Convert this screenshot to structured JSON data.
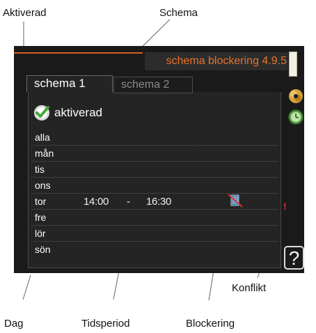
{
  "callouts": {
    "aktiverad": "Aktiverad",
    "schema": "Schema",
    "konflikt": "Konflikt",
    "dag": "Dag",
    "tidsperiod": "Tidsperiod",
    "blockering": "Blockering"
  },
  "screen": {
    "title": "schema blockering 4.9.5",
    "tabs": [
      {
        "label": "schema 1",
        "active": true
      },
      {
        "label": "schema 2",
        "active": false
      }
    ],
    "activated_label": "aktiverad",
    "days": [
      {
        "label": "alla"
      },
      {
        "label": "mån"
      },
      {
        "label": "tis"
      },
      {
        "label": "ons"
      },
      {
        "label": "tor",
        "start": "14:00",
        "separator": "-",
        "end": "16:30",
        "blocking_icon": "heating-blocked-icon",
        "conflict": "!"
      },
      {
        "label": "fre"
      },
      {
        "label": "lör"
      },
      {
        "label": "sön"
      }
    ],
    "help_symbol": "?"
  },
  "icons": {
    "check": "check-icon",
    "blocking": "blocked-heating-icon",
    "sidebar": [
      "scroll-position-bar",
      "tools-icon",
      "clock-icon"
    ],
    "help": "help-icon"
  },
  "colors": {
    "screen_background": "#1a1a1a",
    "title_text": "#e9732b",
    "accent_line": "#d4601f",
    "check_green": "#3da834",
    "conflict_red": "#e03030"
  }
}
